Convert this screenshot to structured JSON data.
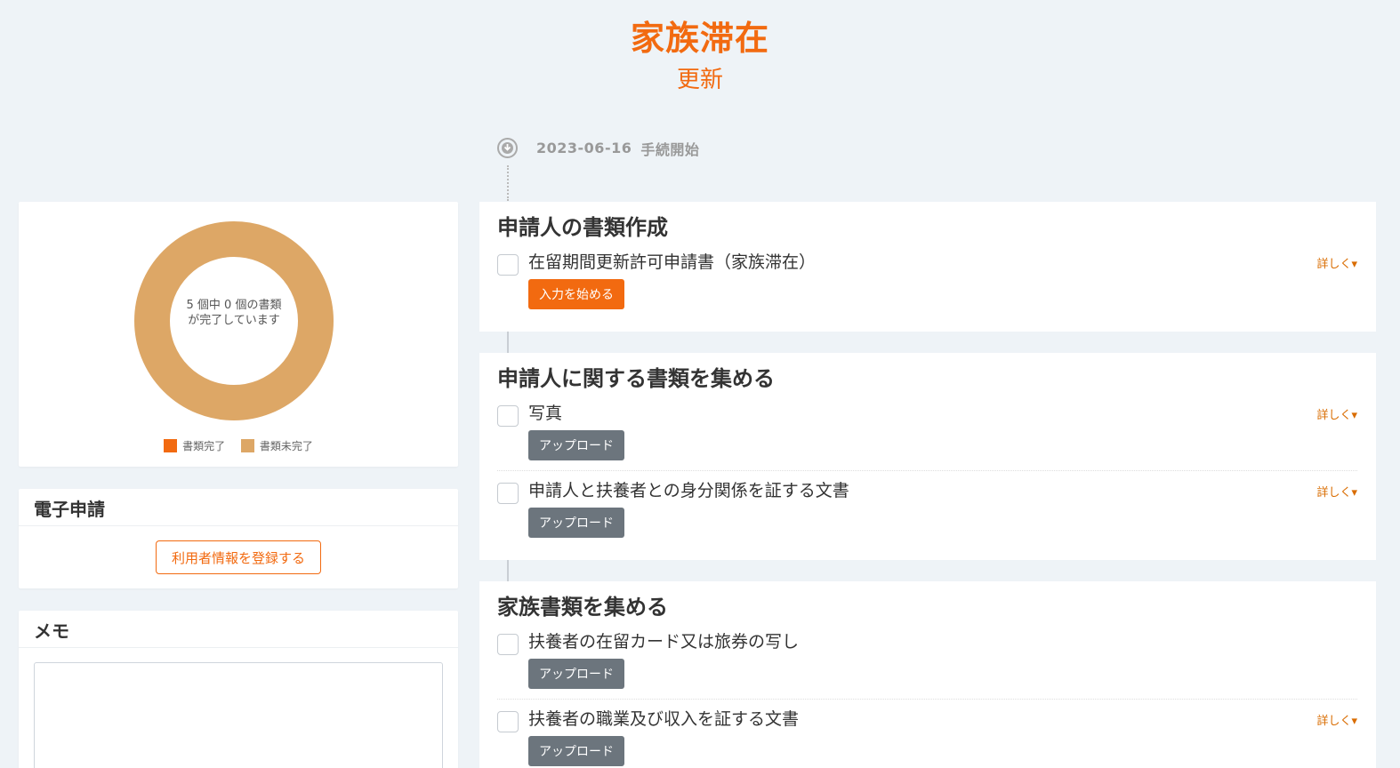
{
  "header": {
    "title": "家族滞在",
    "subtitle": "更新"
  },
  "progress_chart": {
    "center_text": "5 個中 0 個の書類が完了しています",
    "total": 5,
    "completed": 0,
    "legend": [
      {
        "label": "書類完了",
        "color": "#f26a10"
      },
      {
        "label": "書類未完了",
        "color": "#dda766"
      }
    ]
  },
  "efiling": {
    "title": "電子申請",
    "button_label": "利用者情報を登録する"
  },
  "memo": {
    "title": "メモ",
    "value": ""
  },
  "timeline": {
    "start_date": "2023-06-16",
    "start_label": "手続開始",
    "sections": [
      {
        "title": "申請人の書類作成",
        "items": [
          {
            "label": "在留期間更新許可申請書（家族滞在）",
            "button": "入力を始める",
            "detail": "詳しく",
            "checked": false
          }
        ]
      },
      {
        "title": "申請人に関する書類を集める",
        "items": [
          {
            "label": "写真",
            "button": "アップロード",
            "detail": "詳しく",
            "checked": false
          },
          {
            "label": "申請人と扶養者との身分関係を証する文書",
            "button": "アップロード",
            "detail": "詳しく",
            "checked": false
          }
        ]
      },
      {
        "title": "家族書類を集める",
        "items": [
          {
            "label": "扶養者の在留カード又は旅券の写し",
            "button": "アップロード",
            "detail": "",
            "checked": false
          },
          {
            "label": "扶養者の職業及び収入を証する文書",
            "button": "アップロード",
            "detail": "詳しく",
            "checked": false
          }
        ]
      }
    ]
  }
}
